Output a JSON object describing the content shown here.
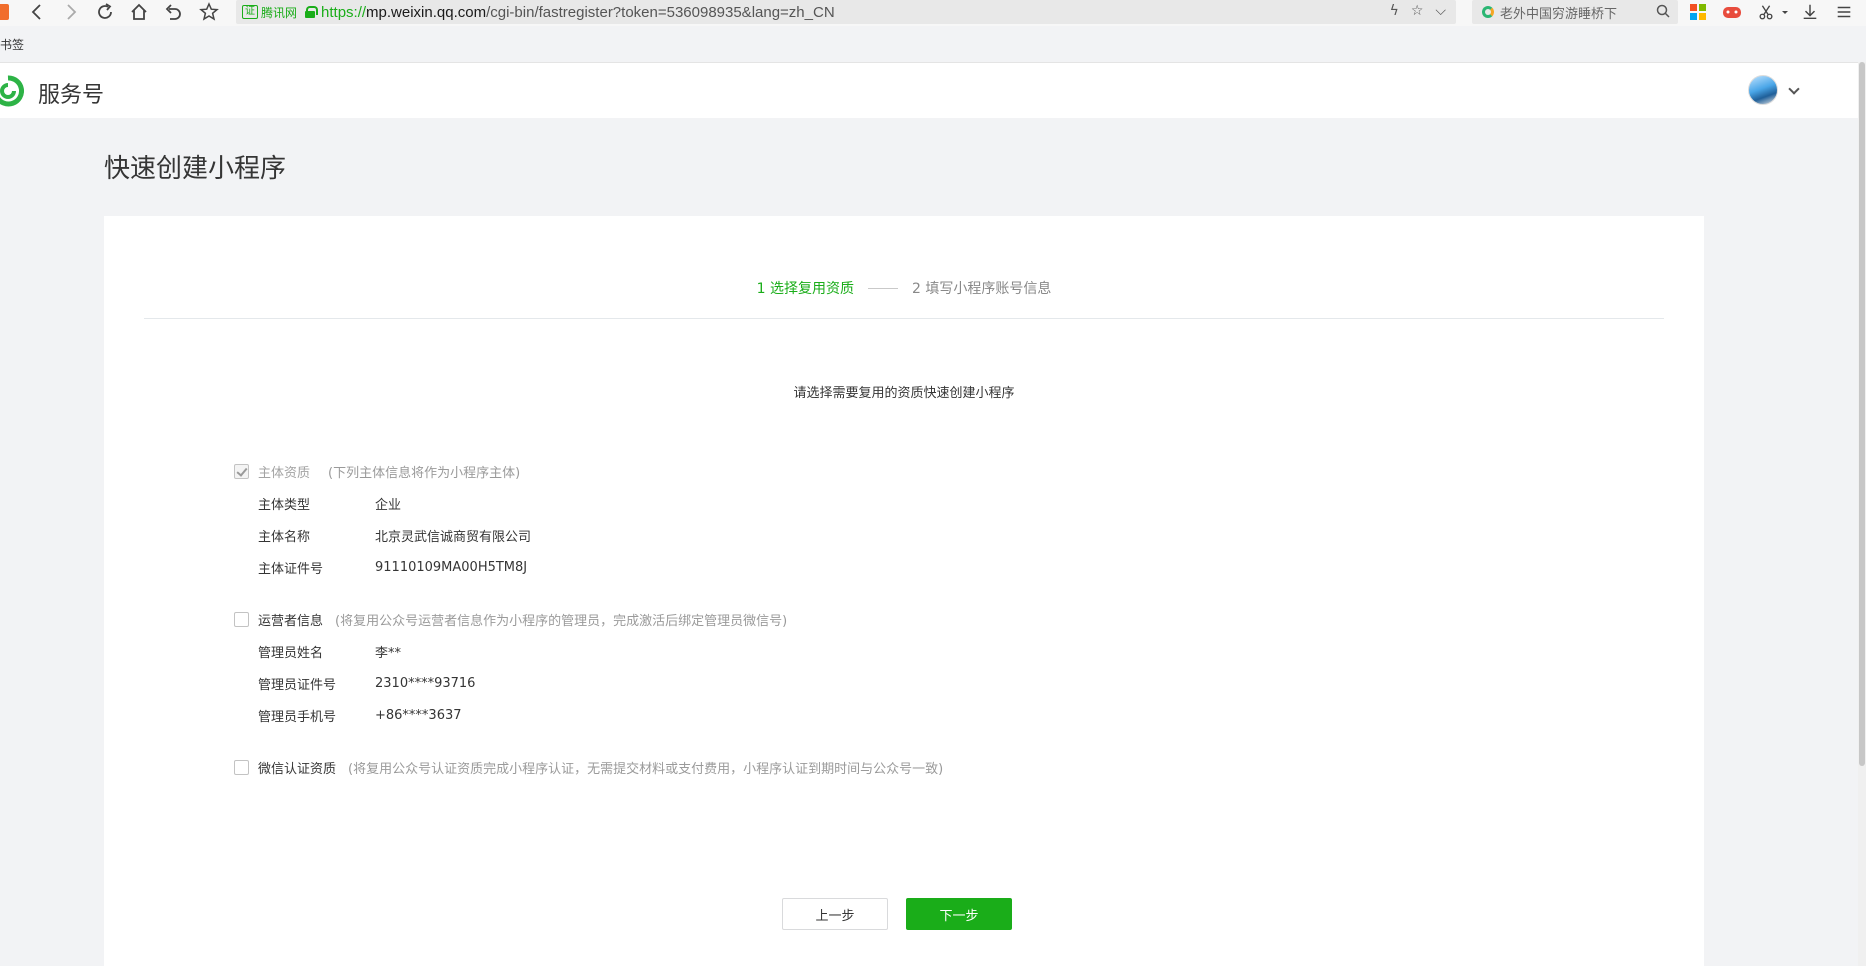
{
  "browser": {
    "address": {
      "cert_badge": "证",
      "cert_issuer": "腾讯网",
      "url_scheme": "https://",
      "url_domain": "mp.weixin.qq.com",
      "url_path": "/cgi-bin/fastregister?token=536098935&lang=zh_CN"
    },
    "search": {
      "placeholder": "老外中国穷游睡桥下"
    },
    "bookmark_label": "书签"
  },
  "header": {
    "brand_name": "服务号"
  },
  "page": {
    "title": "快速创建小程序",
    "steps": [
      {
        "label": "1 选择复用资质",
        "active": true
      },
      {
        "label": "2 填写小程序账号信息",
        "active": false
      }
    ],
    "intro": "请选择需要复用的资质快速创建小程序",
    "sections": {
      "entity": {
        "label": "主体资质",
        "hint": "(下列主体信息将作为小程序主体)",
        "checked": true,
        "disabled": true,
        "fields": [
          {
            "label": "主体类型",
            "value": "企业"
          },
          {
            "label": "主体名称",
            "value": "北京灵武信诚商贸有限公司"
          },
          {
            "label": "主体证件号",
            "value": "91110109MA00H5TM8J"
          }
        ]
      },
      "operator": {
        "label": "运营者信息",
        "hint": "(将复用公众号运营者信息作为小程序的管理员，完成激活后绑定管理员微信号)",
        "checked": false,
        "fields": [
          {
            "label": "管理员姓名",
            "value": "李**"
          },
          {
            "label": "管理员证件号",
            "value": "2310****93716"
          },
          {
            "label": "管理员手机号",
            "value": "+86****3637"
          }
        ]
      },
      "verify": {
        "label": "微信认证资质",
        "hint": "(将复用公众号认证资质完成小程序认证，无需提交材料或支付费用，小程序认证到期时间与公众号一致)",
        "checked": false
      }
    },
    "buttons": {
      "prev": "上一步",
      "next": "下一步"
    }
  },
  "colors": {
    "accent": "#1aad19",
    "background": "#f2f3f5"
  }
}
